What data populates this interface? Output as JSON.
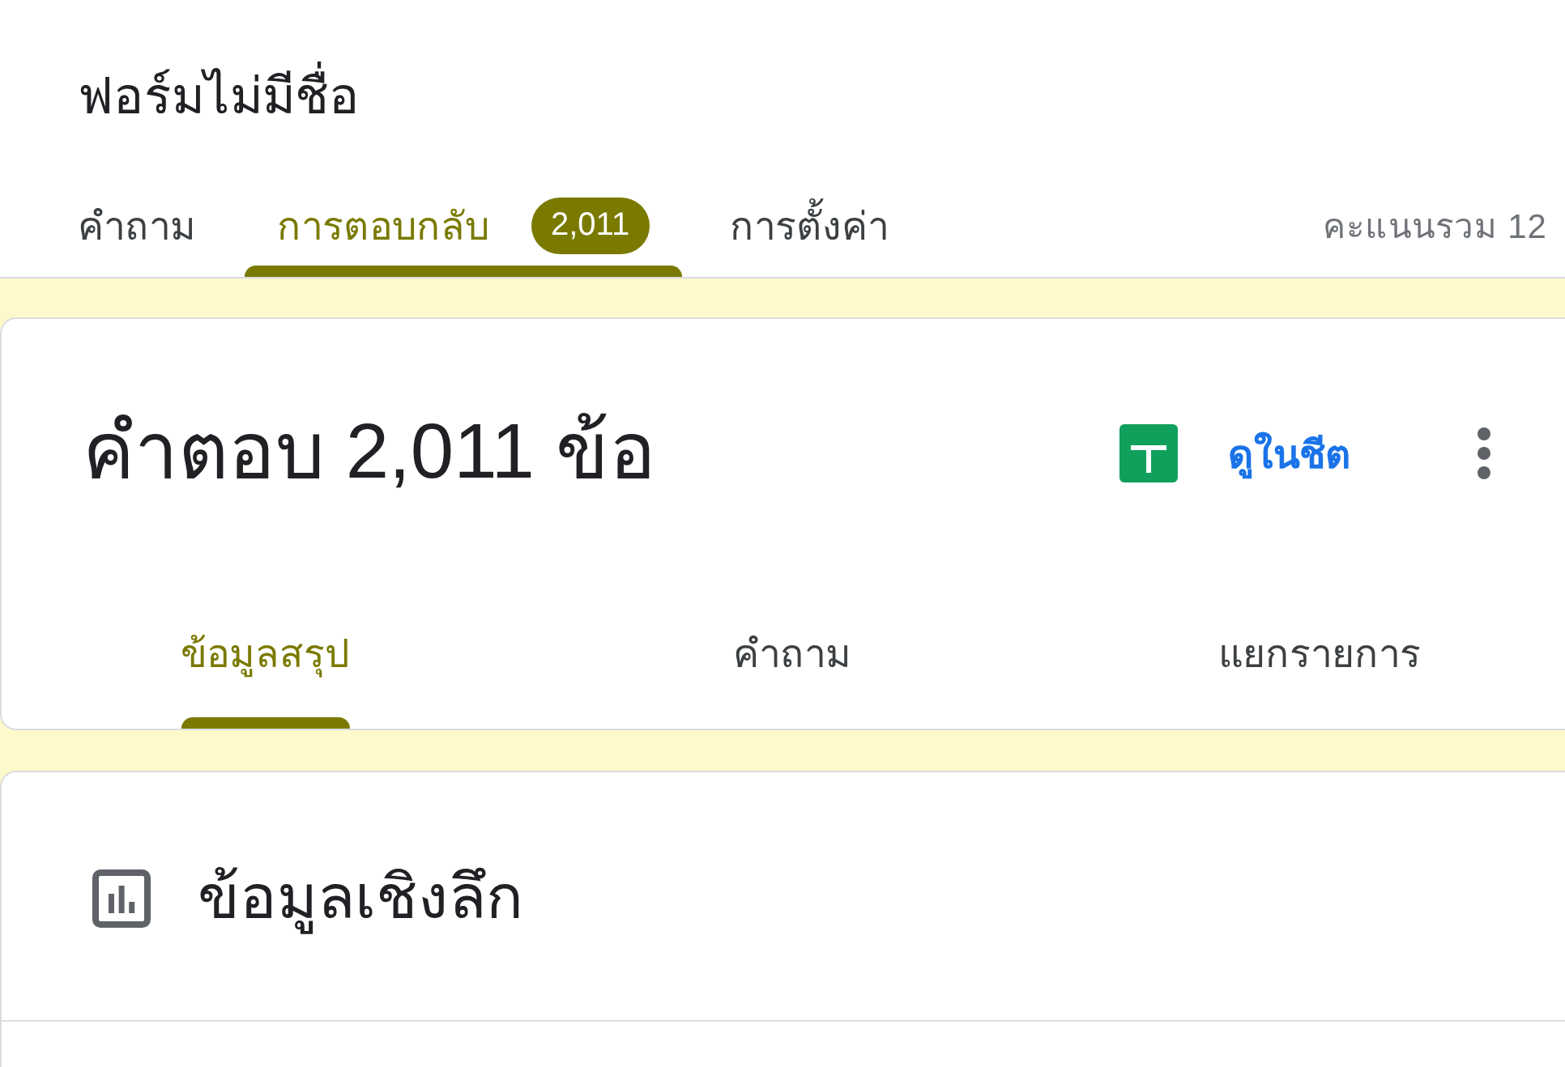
{
  "header": {
    "title": "ฟอร์มไม่มีชื่อ",
    "total_points": "คะแนนรวม 12"
  },
  "tabs": [
    {
      "label": "คำถาม",
      "selected": false
    },
    {
      "label": "การตอบกลับ",
      "selected": true,
      "badge": "2,011"
    },
    {
      "label": "การตั้งค่า",
      "selected": false
    }
  ],
  "responses_card": {
    "heading": "คำตอบ 2,011 ข้อ",
    "sheets_link": "ดูในชีต",
    "subtabs": [
      {
        "label": "ข้อมูลสรุป",
        "selected": true
      },
      {
        "label": "คำถาม",
        "selected": false
      },
      {
        "label": "แยกรายการ",
        "selected": false
      }
    ]
  },
  "insights_card": {
    "title": "ข้อมูลเชิงลึก"
  }
}
